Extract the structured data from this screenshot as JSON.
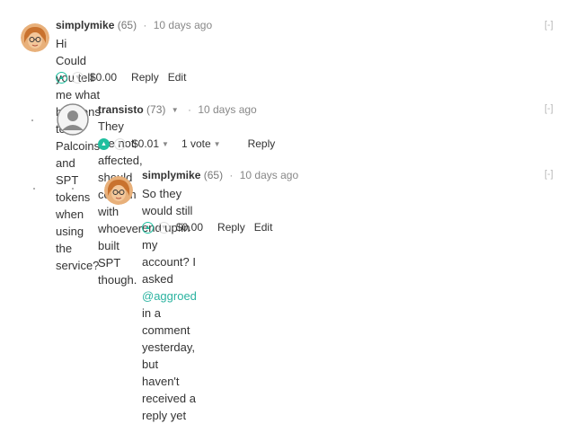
{
  "comments": [
    {
      "author": "simplymike",
      "reputation": "(65)",
      "time": "10 days ago",
      "lines": [
        "Hi",
        "Could you tell me what happens to Palcoins and SPT tokens when using the service?"
      ],
      "payout": "$0.00",
      "reply": "Reply",
      "edit": "Edit",
      "collapse": "[-]"
    },
    {
      "author": "transisto",
      "reputation": "(73)",
      "time": "10 days ago",
      "text": "They are not affected, should confirm with whoever built SPT though.",
      "payout": "$0.01",
      "votes": "1 vote",
      "reply": "Reply",
      "collapse": "[-]"
    },
    {
      "author": "simplymike",
      "reputation": "(65)",
      "time": "10 days ago",
      "text_before": "So they would still end up in my account? I asked ",
      "mention": "@aggroed",
      "text_after": " in a comment yesterday, but",
      "line2": "haven't received a reply yet",
      "payout": "$0.00",
      "reply": "Reply",
      "edit": "Edit",
      "collapse": "[-]"
    }
  ],
  "icons": {
    "upvote": "chevron-up",
    "downvote": "chevron-down",
    "dropdown": "caret-down"
  },
  "colors": {
    "accent": "#1fbf9f",
    "mention": "#2bb3a0"
  }
}
